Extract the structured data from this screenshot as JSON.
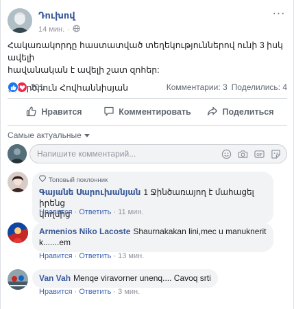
{
  "post": {
    "author": "Դուխով",
    "time": "14 мин.",
    "more": "···",
    "text_line1": "Հակառակորդը հաստատված տեղեկություններով ունի 3 իսկ ավելի",
    "text_line2": "հավանական է ավելի շատ զոհեր:",
    "credit": "(c) Արծրուն Հովհաննիսյան"
  },
  "stats": {
    "reactions_count": "101",
    "comments": "Комментарии: 3",
    "shares": "Поделились: 4",
    "like_color": "#1877f2",
    "love_color": "#f0284a"
  },
  "actions": {
    "like": "Нравится",
    "comment": "Комментировать",
    "share": "Поделиться"
  },
  "sort_label": "Самые актуальные",
  "composer": {
    "placeholder": "Напишите комментарий..."
  },
  "comments": [
    {
      "badge": "Топовый поклонник",
      "name": "Գայանե Սարուխանյան",
      "text": "1 Ջինծառայող է մահացել իրենց",
      "text2": "կողմից",
      "like": "Нравится",
      "reply": "Ответить",
      "time": "11 мин."
    },
    {
      "name": "Armenios Niko Lacoste",
      "text": "Shaurnakakan lini,mec u manuknerit",
      "text2": "k.......em",
      "like": "Нравится",
      "reply": "Ответить",
      "time": "13 мин."
    },
    {
      "name": "Van Vah",
      "text": "Menqe viravorner unenq.... Cavoq srti",
      "like": "Нравится",
      "reply": "Ответить",
      "time": "3 мин."
    }
  ]
}
